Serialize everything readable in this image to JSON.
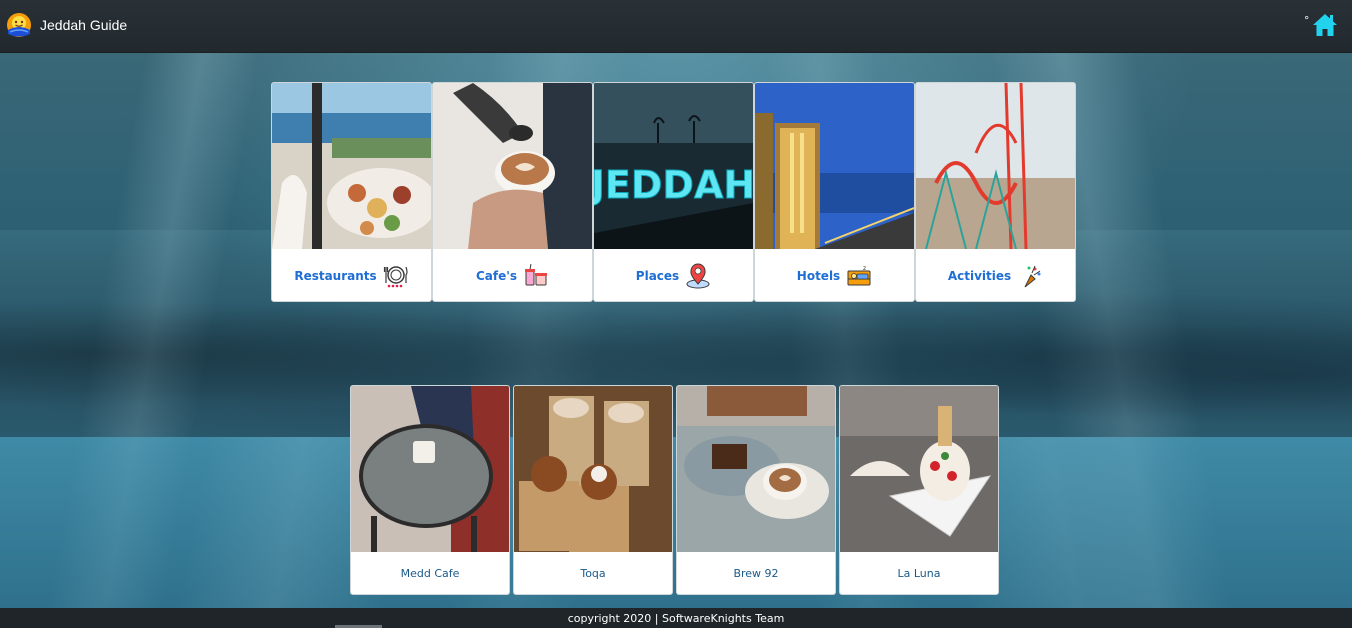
{
  "navbar": {
    "brand_title": "Jeddah Guide",
    "degree_symbol": "°",
    "brand_icon": "sun-logo-icon",
    "home_icon": "home-icon",
    "accent_color": "#22d3ee"
  },
  "categories": [
    {
      "label": "Restaurants",
      "icon": "dining-plate-icon"
    },
    {
      "label": "Cafe's",
      "icon": "coffee-cups-icon"
    },
    {
      "label": "Places",
      "icon": "map-pin-icon"
    },
    {
      "label": "Hotels",
      "icon": "hotel-bed-icon"
    },
    {
      "label": "Activities",
      "icon": "party-popper-icon"
    }
  ],
  "places": [
    {
      "label": "Medd Cafe"
    },
    {
      "label": "Toqa"
    },
    {
      "label": "Brew 92"
    },
    {
      "label": "La Luna"
    }
  ],
  "category_image_texts": {
    "places": "JEDDAH"
  },
  "footer": {
    "text": "copyright 2020 | SoftwareKnights Team"
  },
  "colors": {
    "category_label": "#1f6ed4",
    "place_label": "#1a5a8a",
    "navbar_bg": "#262d31"
  }
}
